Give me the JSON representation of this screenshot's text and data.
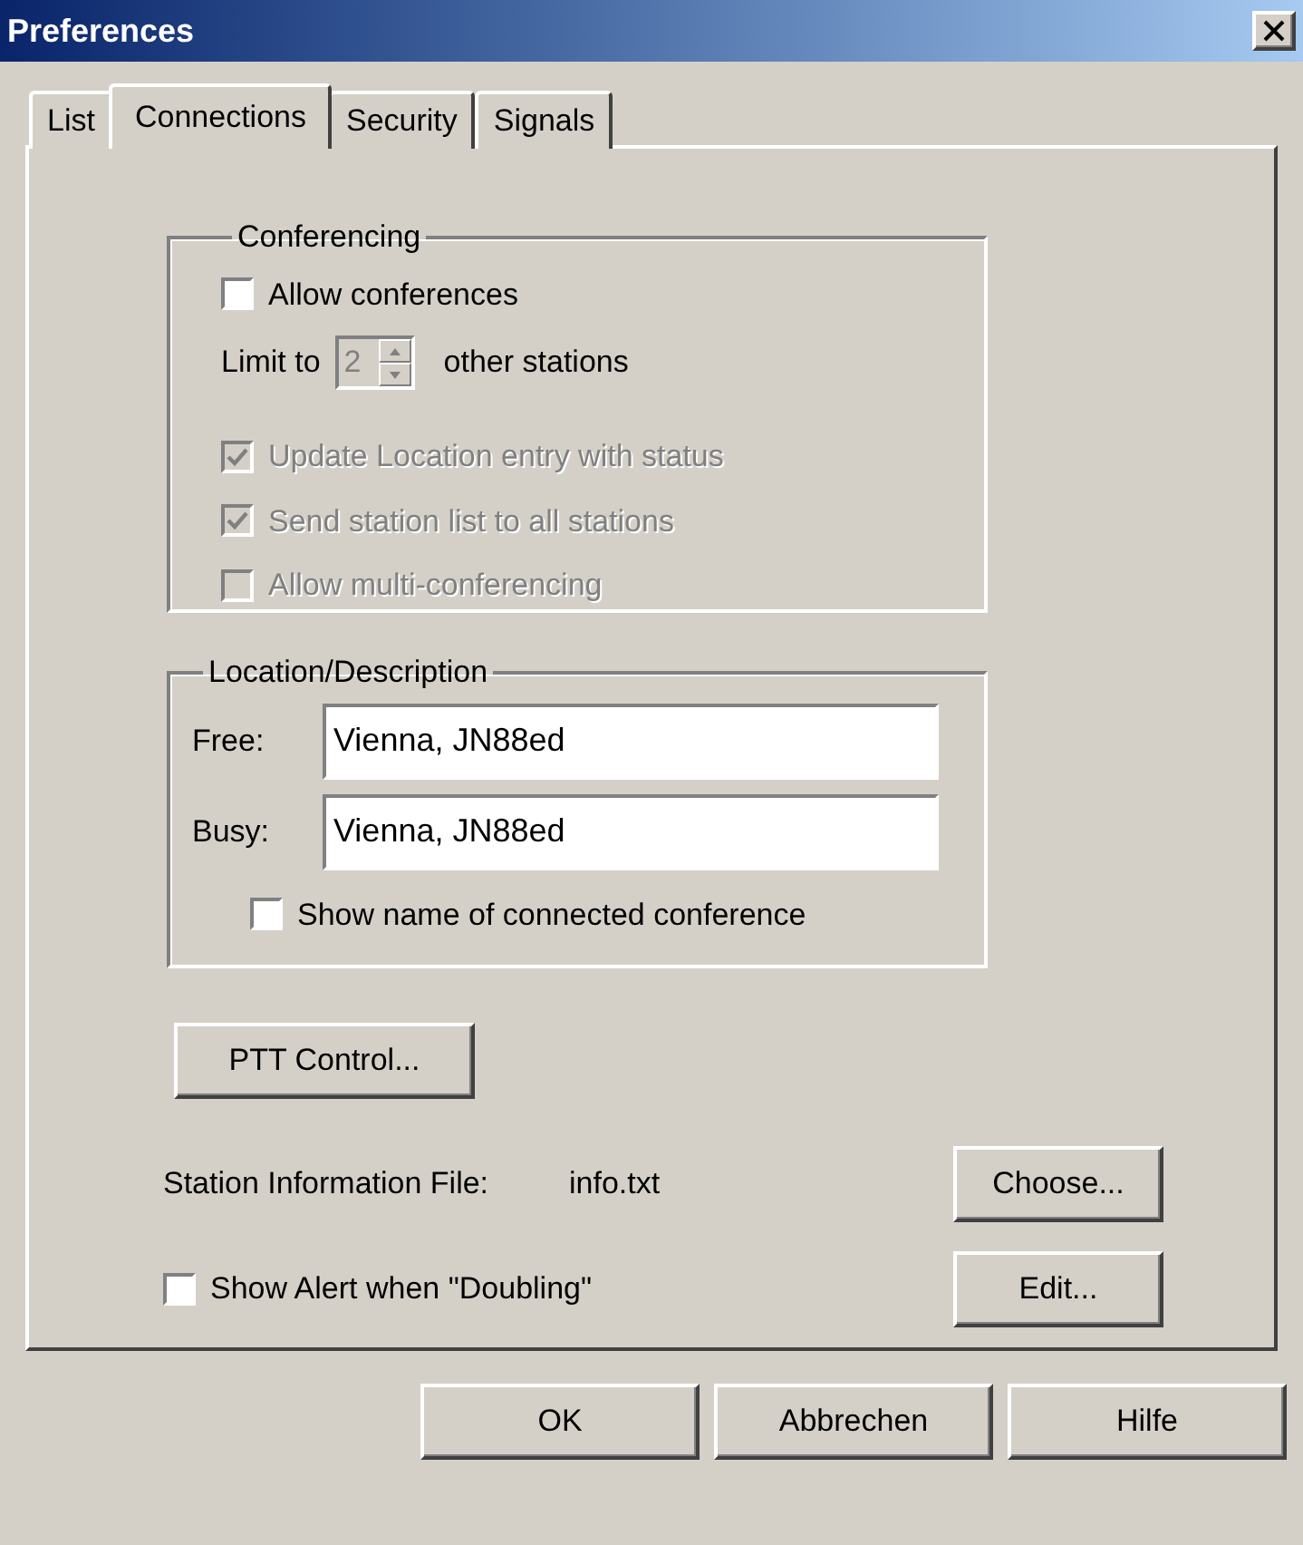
{
  "window": {
    "title": "Preferences"
  },
  "tabs": [
    {
      "label": "List",
      "selected": false
    },
    {
      "label": "Connections",
      "selected": true
    },
    {
      "label": "Security",
      "selected": false
    },
    {
      "label": "Signals",
      "selected": false
    }
  ],
  "conferencing": {
    "title": "Conferencing",
    "allow": {
      "label": "Allow conferences",
      "checked": false,
      "disabled": false
    },
    "limit": {
      "label": "Limit to",
      "value": "2",
      "suffix": "other stations",
      "disabled": true
    },
    "options": [
      {
        "label": "Update Location entry with status",
        "checked": true,
        "disabled": true
      },
      {
        "label": "Send station list to all stations",
        "checked": true,
        "disabled": true
      },
      {
        "label": "Allow multi-conferencing",
        "checked": false,
        "disabled": true
      }
    ]
  },
  "location": {
    "title": "Location/Description",
    "fields": [
      {
        "label": "Free:",
        "value": "Vienna, JN88ed"
      },
      {
        "label": "Busy:",
        "value": "Vienna, JN88ed"
      }
    ],
    "show_name": {
      "label": "Show name of connected conference",
      "checked": false,
      "disabled": false
    }
  },
  "ptt_button": "PTT Control...",
  "station_info": {
    "label": "Station Information File:",
    "value": "info.txt",
    "button": "Choose..."
  },
  "alert": {
    "label": "Show Alert when \"Doubling\"",
    "checked": false,
    "disabled": false,
    "button": "Edit..."
  },
  "buttons": [
    "OK",
    "Abbrechen",
    "Hilfe"
  ]
}
